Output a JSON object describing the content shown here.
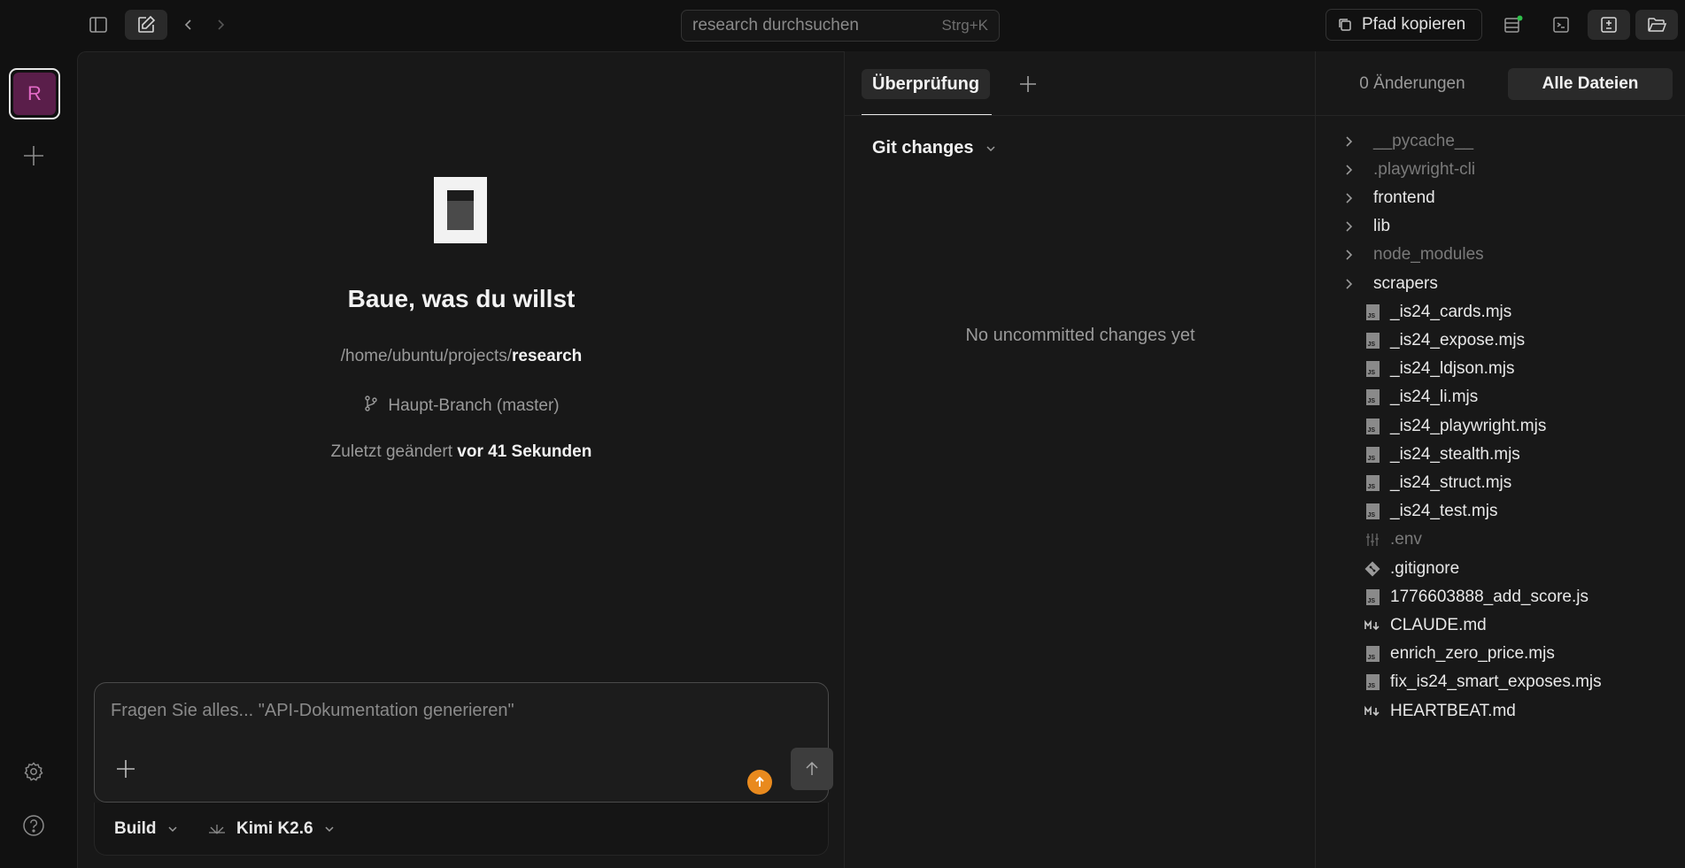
{
  "topbar": {
    "search_placeholder": "research durchsuchen",
    "search_shortcut": "Strg+K",
    "copy_path_label": "Pfad kopieren",
    "status_dot_color": "#2fbf4a"
  },
  "rail": {
    "workspace_initial": "R"
  },
  "hero": {
    "title": "Baue, was du willst",
    "path_prefix": "/home/ubuntu/projects/",
    "path_project": "research",
    "branch": "Haupt-Branch (master)",
    "modified_label": "Zuletzt geändert",
    "modified_value": "vor 41 Sekunden"
  },
  "composer": {
    "placeholder": "Fragen Sie alles... \"API-Dokumentation generieren\"",
    "mode": "Build",
    "model": "Kimi K2.6",
    "accent_color": "#e98a1e"
  },
  "review": {
    "tab_label": "Überprüfung",
    "section_label": "Git changes",
    "empty_text": "No uncommitted changes yet"
  },
  "files": {
    "tab_changes": "0 Änderungen",
    "tab_all": "Alle Dateien",
    "items": [
      {
        "name": "__pycache__",
        "kind": "folder",
        "dim": true
      },
      {
        "name": ".playwright-cli",
        "kind": "folder",
        "dim": true
      },
      {
        "name": "frontend",
        "kind": "folder",
        "dim": false
      },
      {
        "name": "lib",
        "kind": "folder",
        "dim": false
      },
      {
        "name": "node_modules",
        "kind": "folder",
        "dim": true
      },
      {
        "name": "scrapers",
        "kind": "folder",
        "dim": false
      },
      {
        "name": "_is24_cards.mjs",
        "kind": "js",
        "dim": false
      },
      {
        "name": "_is24_expose.mjs",
        "kind": "js",
        "dim": false
      },
      {
        "name": "_is24_ldjson.mjs",
        "kind": "js",
        "dim": false
      },
      {
        "name": "_is24_li.mjs",
        "kind": "js",
        "dim": false
      },
      {
        "name": "_is24_playwright.mjs",
        "kind": "js",
        "dim": false
      },
      {
        "name": "_is24_stealth.mjs",
        "kind": "js",
        "dim": false
      },
      {
        "name": "_is24_struct.mjs",
        "kind": "js",
        "dim": false
      },
      {
        "name": "_is24_test.mjs",
        "kind": "js",
        "dim": false
      },
      {
        "name": ".env",
        "kind": "env",
        "dim": true
      },
      {
        "name": ".gitignore",
        "kind": "git",
        "dim": false
      },
      {
        "name": "1776603888_add_score.js",
        "kind": "js",
        "dim": false
      },
      {
        "name": "CLAUDE.md",
        "kind": "md",
        "dim": false
      },
      {
        "name": "enrich_zero_price.mjs",
        "kind": "js",
        "dim": false
      },
      {
        "name": "fix_is24_smart_exposes.mjs",
        "kind": "js",
        "dim": false
      },
      {
        "name": "HEARTBEAT.md",
        "kind": "md",
        "dim": false
      }
    ]
  }
}
